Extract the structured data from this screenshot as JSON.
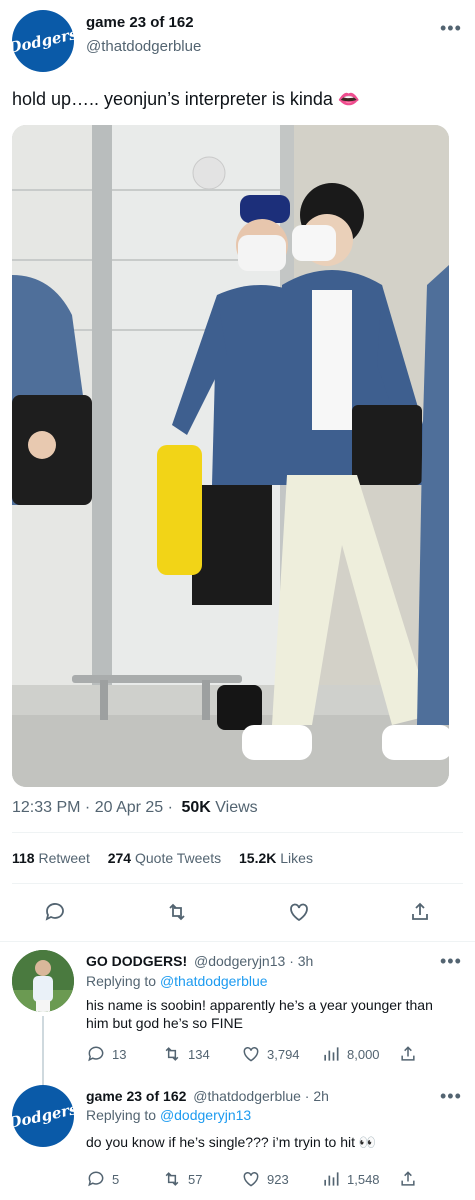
{
  "main_tweet": {
    "display_name": "game 23 of 162",
    "handle": "@thatdodgerblue",
    "avatar_text": "Dodgers",
    "text": "hold up….. yeonjun’s interpreter is kinda 👄",
    "timestamp": "12:33 PM · 20 Apr 25 ·",
    "views_count": "50K",
    "views_label": "Views",
    "retweets_count": "118",
    "retweets_label": "Retweet",
    "quotes_count": "274",
    "quotes_label": "Quote Tweets",
    "likes_count": "15.2K",
    "likes_label": "Likes"
  },
  "replies": [
    {
      "display_name": "GO DODGERS!",
      "handle": "@dodgeryjn13",
      "time": "· 3h",
      "replying_label": "Replying to",
      "replying_to": "@thatdodgerblue",
      "text": "his name is soobin! apparently he’s a year younger than him but god he’s so FINE",
      "replies": "13",
      "retweets": "134",
      "likes": "3,794",
      "views": "8,000"
    },
    {
      "display_name": "game 23 of 162",
      "handle": "@thatdodgerblue",
      "time": "· 2h",
      "replying_label": "Replying to",
      "replying_to": "@dodgeryjn13",
      "text": "do you know if he’s single??? i’m tryin to hit 👀",
      "replies": "5",
      "retweets": "57",
      "likes": "923",
      "views": "1,548",
      "avatar_text": "Dodgers"
    }
  ],
  "icons": {
    "reply": "speech-bubble-icon",
    "retweet": "retweet-icon",
    "like": "heart-icon",
    "share": "share-icon",
    "views": "bar-chart-icon",
    "more": "more-dots-icon"
  },
  "colors": {
    "dodger_blue": "#0a5aa8",
    "link_blue": "#1d9bf0",
    "muted_text": "#536471",
    "denim": "#3e5f8f"
  }
}
